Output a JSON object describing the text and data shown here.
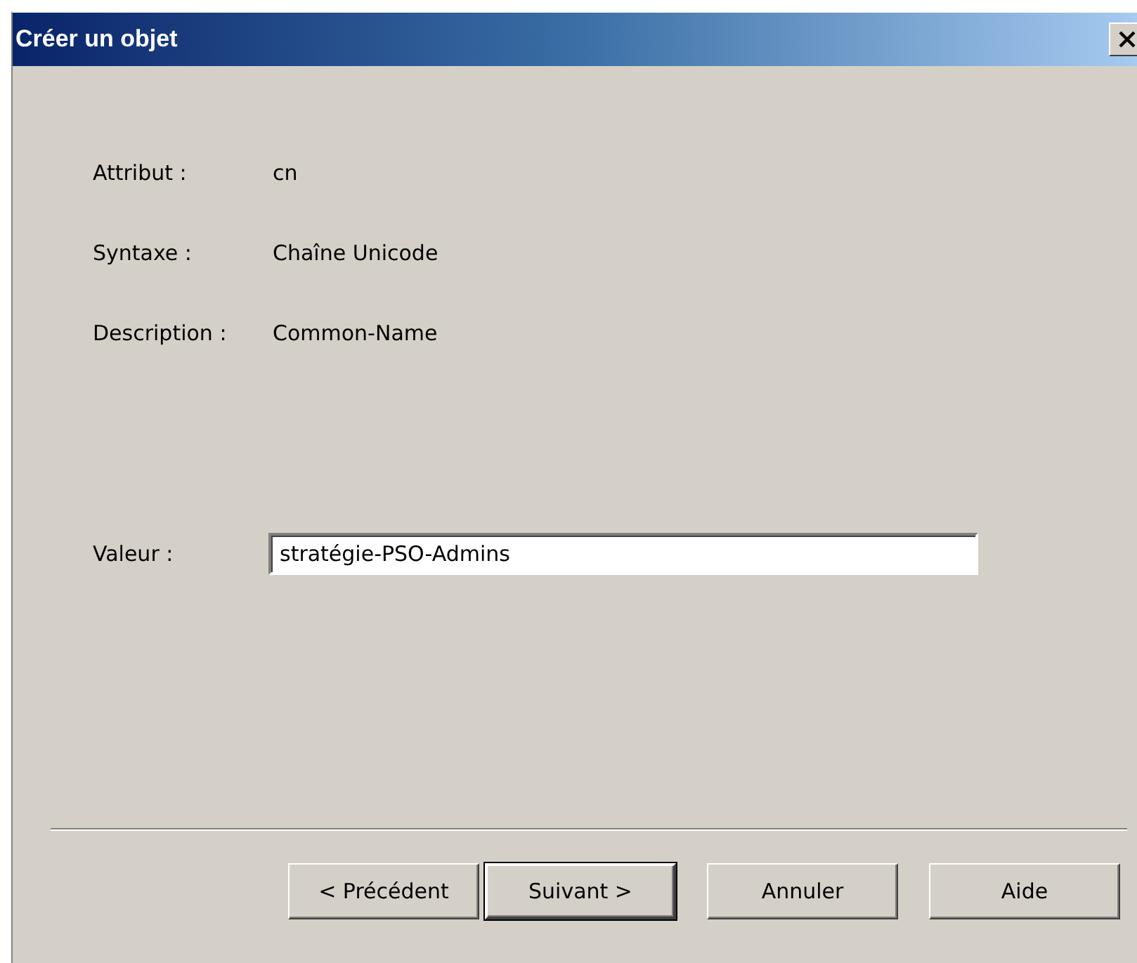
{
  "window": {
    "title": "Créer un objet"
  },
  "attributes": [
    {
      "label": "Attribut :",
      "value": "cn"
    },
    {
      "label": "Syntaxe :",
      "value": "Chaîne Unicode"
    },
    {
      "label": "Description :",
      "value": "Common-Name"
    }
  ],
  "value_field": {
    "label": "Valeur :",
    "value": "stratégie-PSO-Admins"
  },
  "buttons": [
    {
      "label": "< Précédent",
      "default": false
    },
    {
      "label": "Suivant >",
      "default": true
    },
    {
      "label": "Annuler",
      "default": false
    },
    {
      "label": "Aide",
      "default": false
    }
  ]
}
